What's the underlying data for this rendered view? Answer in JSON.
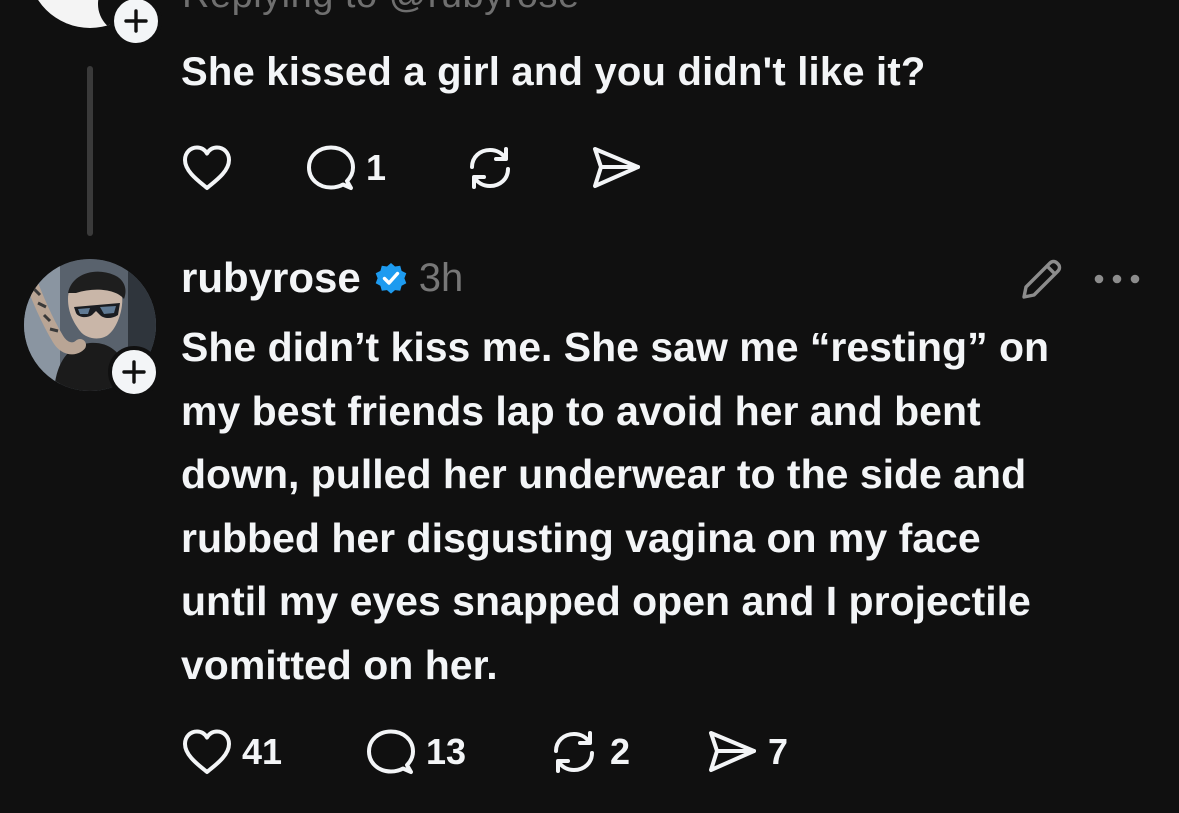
{
  "reply_post": {
    "replying_to": "Replying to @rubyrose",
    "text": "She kissed a girl and you didn't like it?",
    "actions": {
      "like_icon": "heart-icon",
      "comment_icon": "comment-icon",
      "comment_count": "1",
      "repost_icon": "repost-icon",
      "share_icon": "send-icon"
    }
  },
  "main_post": {
    "username": "rubyrose",
    "verified_icon": "verified-badge-icon",
    "verified_color": "#1d9bf0",
    "timestamp": "3h",
    "edit_icon": "pencil-icon",
    "more_icon": "more-dots-icon",
    "text_lines": [
      "She didn’t kiss me. She saw me “resting” on",
      "my best friends lap to avoid her and bent",
      "down, pulled her underwear to the side and",
      "rubbed her disgusting vagina on my face",
      "until my eyes snapped open and I projectile",
      "vomitted on her."
    ],
    "actions": {
      "like_count": "41",
      "comment_count": "13",
      "repost_count": "2",
      "share_count": "7"
    }
  },
  "theme": {
    "background": "#101010",
    "text": "#f3f5f7",
    "muted": "#777777"
  }
}
